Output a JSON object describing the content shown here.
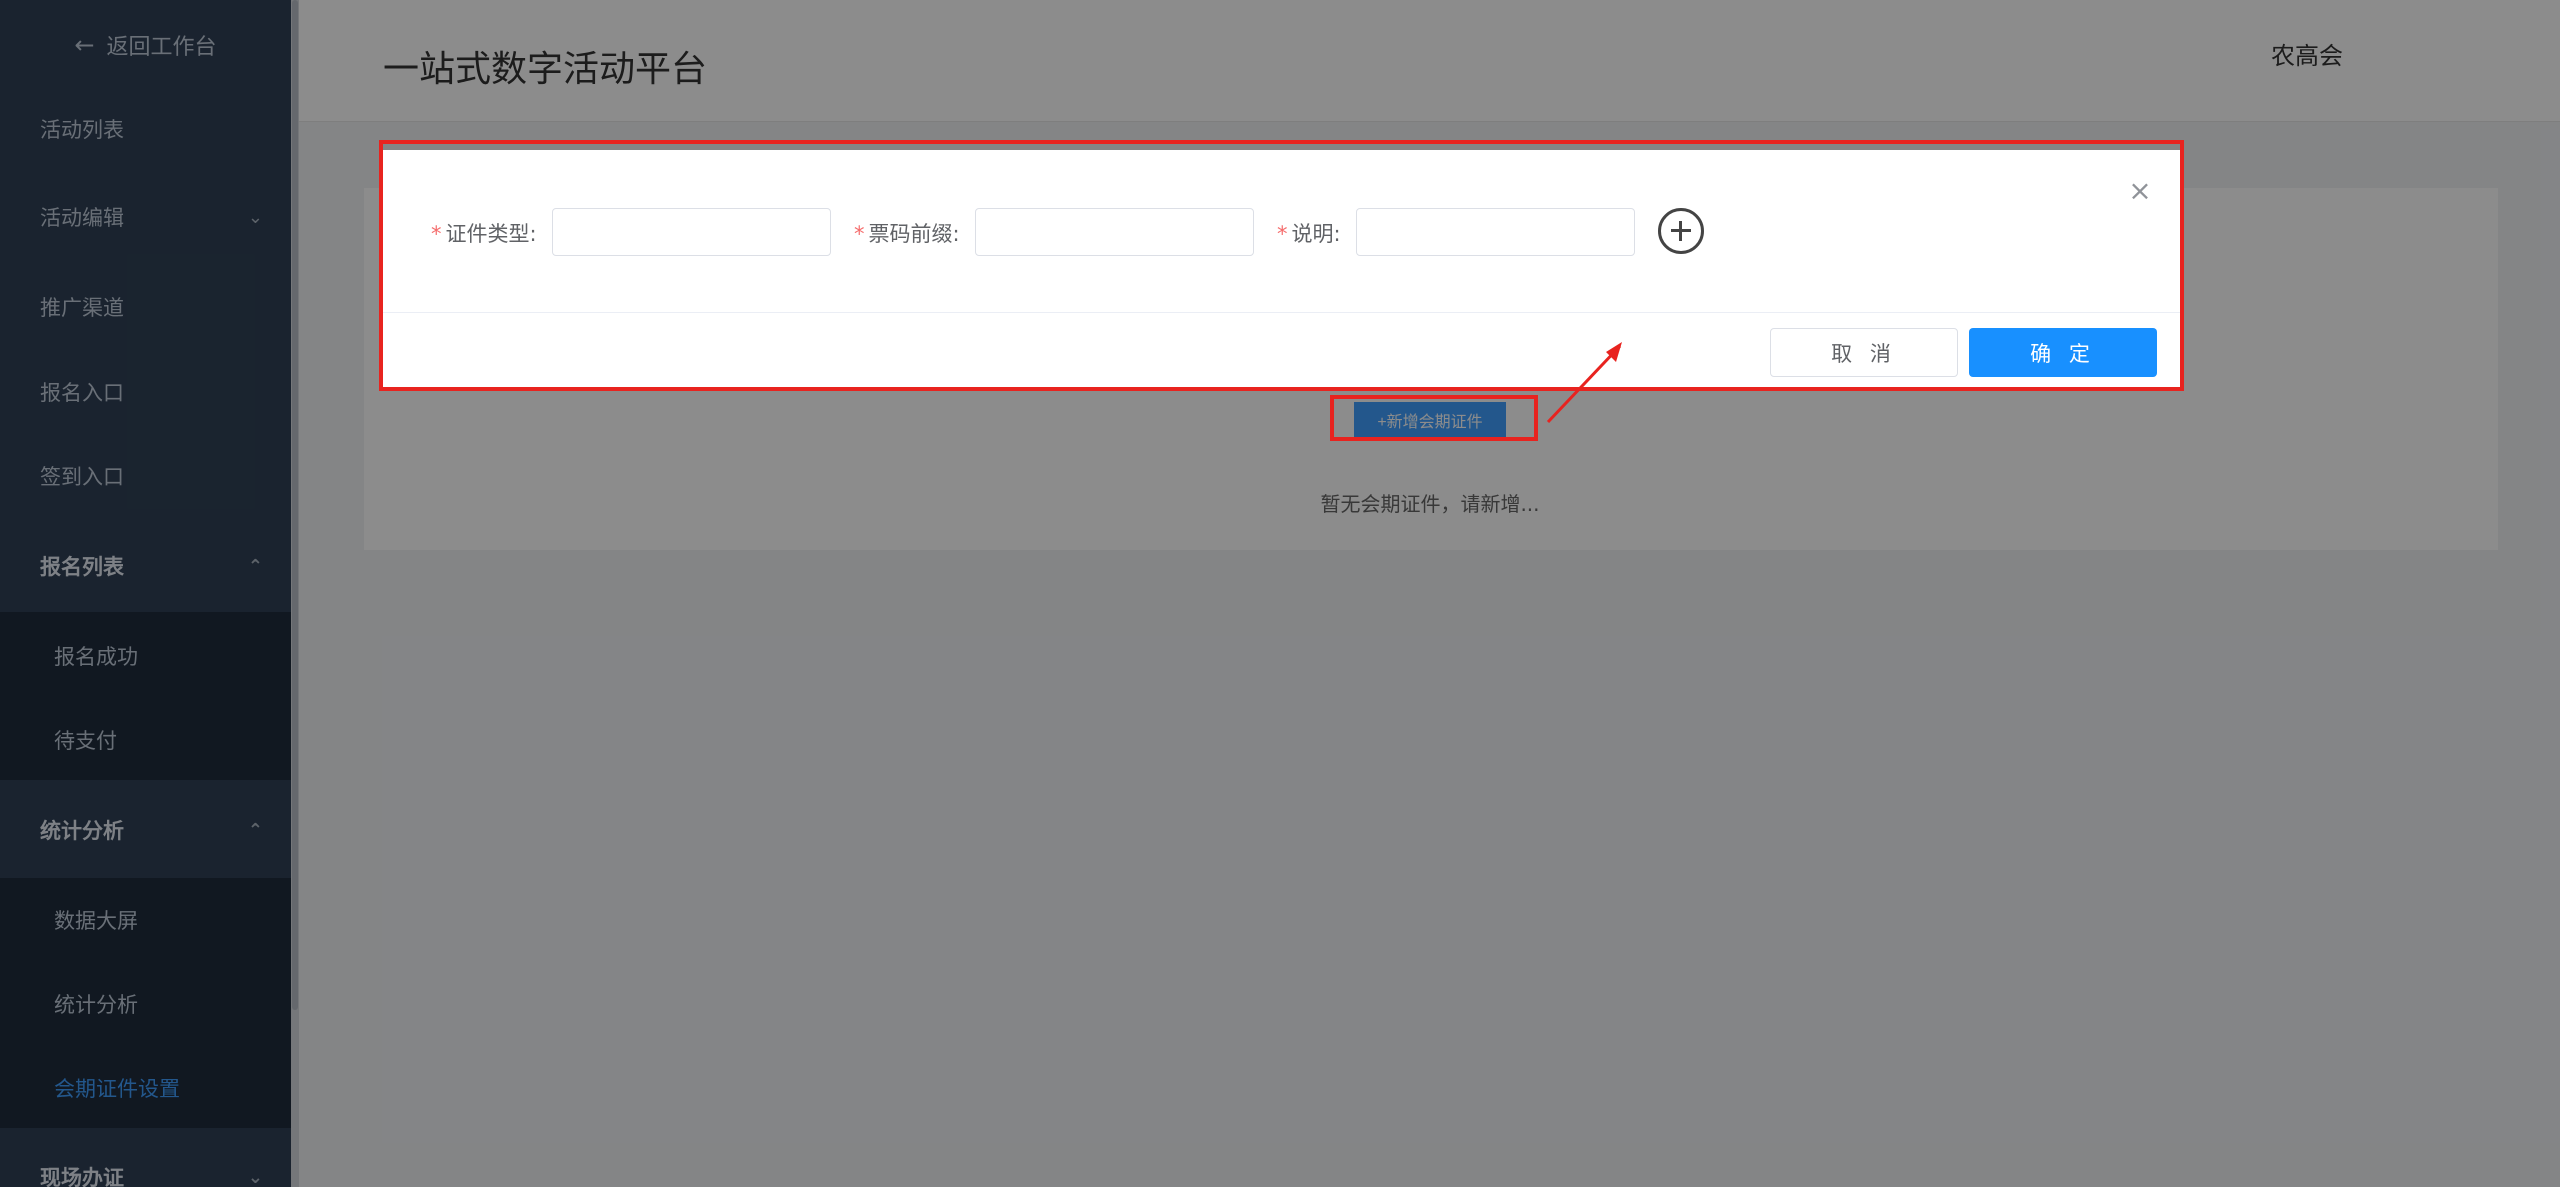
{
  "sidebar": {
    "back_label": "返回工作台",
    "items": [
      {
        "label": "活动列表"
      },
      {
        "label": "活动编辑"
      },
      {
        "label": "推广渠道"
      },
      {
        "label": "报名入口"
      },
      {
        "label": "签到入口"
      },
      {
        "label": "报名列表"
      },
      {
        "label": "报名成功"
      },
      {
        "label": "待支付"
      },
      {
        "label": "统计分析"
      },
      {
        "label": "数据大屏"
      },
      {
        "label": "统计分析"
      },
      {
        "label": "会期证件设置"
      },
      {
        "label": "现场办证"
      }
    ]
  },
  "header": {
    "title": "一站式数字活动平台",
    "user": "农高会"
  },
  "main": {
    "add_button_label": "+新增会期证件",
    "empty_text": "暂无会期证件，请新增..."
  },
  "dialog": {
    "fields": [
      {
        "label": "证件类型:",
        "value": ""
      },
      {
        "label": "票码前缀:",
        "value": ""
      },
      {
        "label": "说明:",
        "value": ""
      }
    ],
    "required_mark": "*",
    "close_glyph": "×",
    "cancel_label": "取 消",
    "confirm_label": "确 定"
  },
  "colors": {
    "sidebar_bg": "#304156",
    "primary": "#1890ff",
    "annotation": "#e8231f"
  }
}
